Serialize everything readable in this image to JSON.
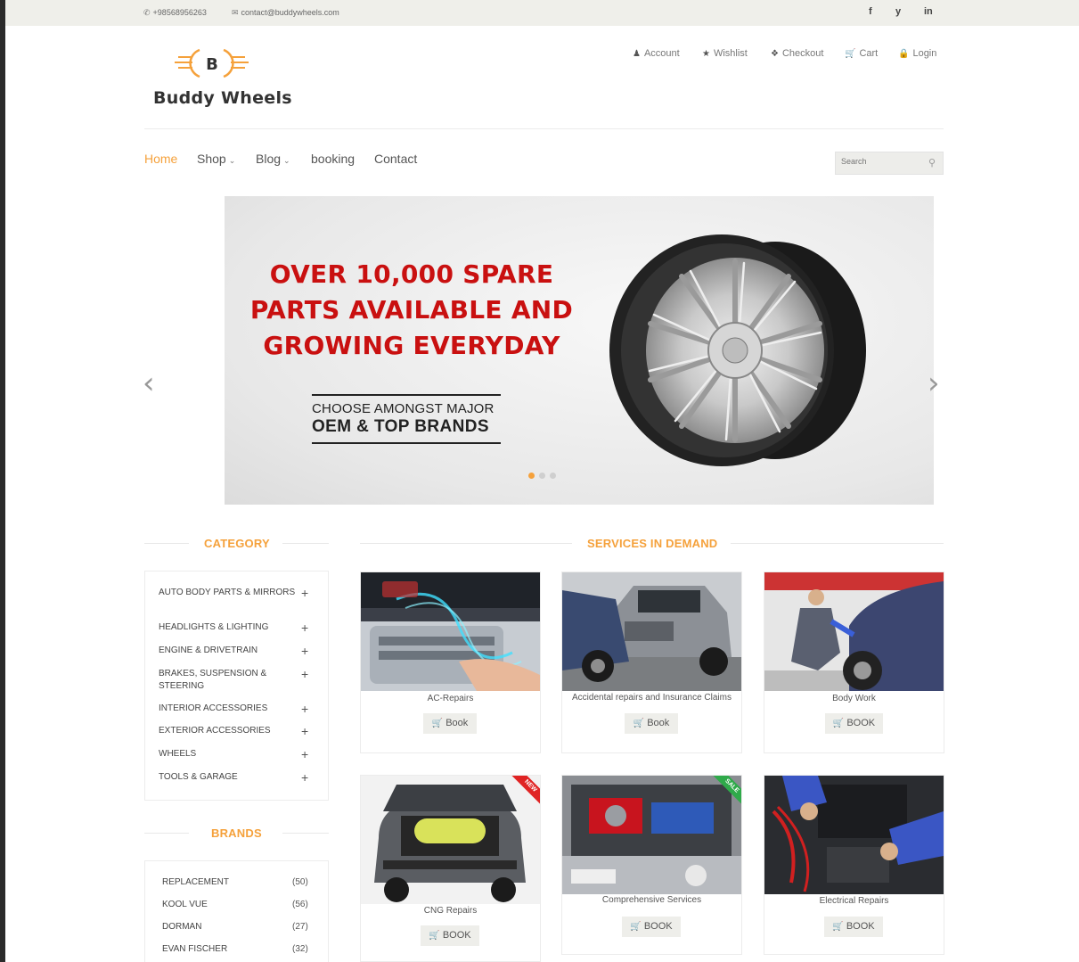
{
  "topbar": {
    "phone": "+98568956263",
    "email": "contact@buddywheels.com",
    "social": [
      "f",
      "y",
      "in"
    ]
  },
  "brand": {
    "logo_letter": "B",
    "name": "Buddy Wheels",
    "accent": "#f5a13b"
  },
  "account_links": [
    {
      "icon": "user-icon",
      "label": "Account"
    },
    {
      "icon": "star-icon",
      "label": "Wishlist"
    },
    {
      "icon": "crosshair-icon",
      "label": "Checkout"
    },
    {
      "icon": "cart-icon",
      "label": "Cart"
    },
    {
      "icon": "lock-icon",
      "label": "Login"
    }
  ],
  "nav": {
    "items": [
      "Home",
      "Shop",
      "Blog",
      "booking",
      "Contact"
    ],
    "active": "Home"
  },
  "search": {
    "placeholder": "Search"
  },
  "hero": {
    "headline_1": "OVER 10,000 SPARE",
    "headline_2": "PARTS AVAILABLE AND",
    "headline_3": "GROWING EVERYDAY",
    "sub_1": "CHOOSE AMONGST MAJOR",
    "sub_2": "OEM & TOP BRANDS",
    "headline_color": "#c91010",
    "slides": 3,
    "active_slide": 1
  },
  "category": {
    "title": "CATEGORY",
    "items": [
      "AUTO BODY PARTS & MIRRORS",
      "HEADLIGHTS & LIGHTING",
      "ENGINE & DRIVETRAIN",
      "BRAKES, SUSPENSION & STEERING",
      "INTERIOR ACCESSORIES",
      "EXTERIOR ACCESSORIES",
      "WHEELS",
      "TOOLS & GARAGE"
    ]
  },
  "brands": {
    "title": "BRANDS",
    "items": [
      {
        "name": "REPLACEMENT",
        "count": "(50)"
      },
      {
        "name": "KOOL VUE",
        "count": "(56)"
      },
      {
        "name": "DORMAN",
        "count": "(27)"
      },
      {
        "name": "EVAN FISCHER",
        "count": "(32)"
      }
    ]
  },
  "services": {
    "title": "SERVICES IN DEMAND",
    "items": [
      {
        "label": "AC-Repairs",
        "button": "Book"
      },
      {
        "label": "Accidental repairs and Insurance Claims",
        "button": "Book"
      },
      {
        "label": "Body Work",
        "button": "BOOK"
      },
      {
        "label": "CNG Repairs",
        "button": "BOOK",
        "ribbon": "NEW"
      },
      {
        "label": "Comprehensive Services",
        "button": "BOOK",
        "ribbon": "SALE"
      },
      {
        "label": "Electrical Repairs",
        "button": "BOOK"
      }
    ]
  }
}
